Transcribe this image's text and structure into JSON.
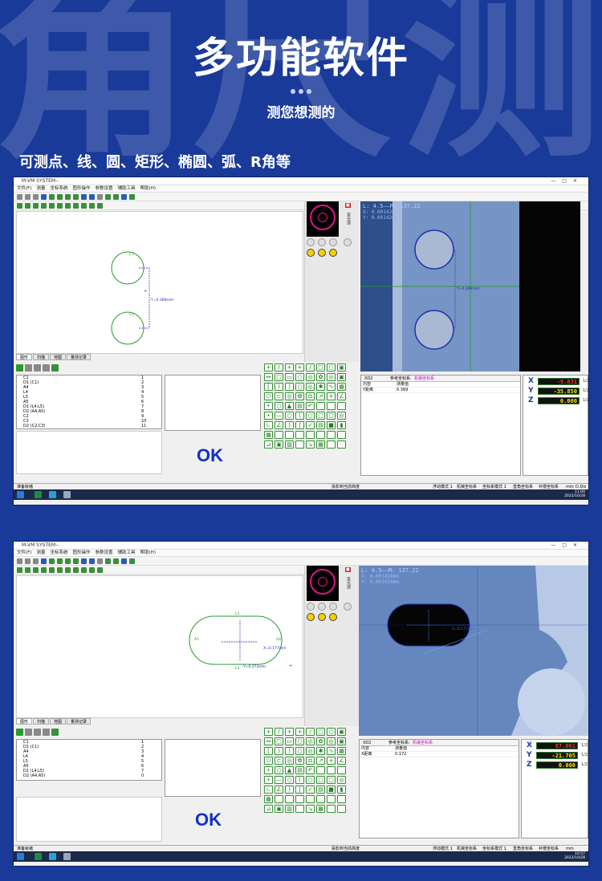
{
  "hero": {
    "background_chars": [
      "角",
      "尺",
      "测"
    ],
    "title": "多功能软件",
    "subtitle": "测您想测的",
    "feature_line": "可测点、线、圆、矩形、椭圆、弧、R角等"
  },
  "screens": [
    {
      "window_title": "M-VM SYSTEM--",
      "window_controls": [
        "—",
        "□",
        "✕"
      ],
      "menu": [
        "文件(F)",
        "测量",
        "坐标系统",
        "图形操作",
        "参数设置",
        "辅助工具",
        "帮助(H)"
      ],
      "drawing_labels": {
        "c_top": "C7",
        "c_bottom": "C3",
        "dimension": "Y=0.369mm"
      },
      "canvas_tabs": [
        "图形",
        "扫描",
        "地图",
        "量测记录"
      ],
      "cam_side_label": "查光源",
      "camera_readout": {
        "line1": "L: 4.5——M: 137.22",
        "line2": "X: 0.001428mm",
        "line3": "Y: 0.001426mm",
        "dimension": "Y=0.369mm"
      },
      "steps": [
        {
          "label": "C1",
          "num": "1"
        },
        {
          "label": "D1 (C1)",
          "num": "2"
        },
        {
          "label": "A4",
          "num": "3"
        },
        {
          "label": "L4",
          "num": "4"
        },
        {
          "label": "L5",
          "num": "5"
        },
        {
          "label": "A5",
          "num": "6"
        },
        {
          "label": "D1 (L4,L5)",
          "num": "7"
        },
        {
          "label": "D2 (A4,A5)",
          "num": "8"
        },
        {
          "label": "C2",
          "num": "9"
        },
        {
          "label": "C3",
          "num": "10"
        },
        {
          "label": "D2 (C2,C3)",
          "num": "11"
        }
      ],
      "ok_text": "OK",
      "results": {
        "id": "XD2",
        "ref_label": "参考坐标系:",
        "ref_value": "机械坐标系",
        "col1": "内容",
        "col2": "测量值",
        "rows": [
          {
            "name": "Y距离",
            "value": "0.369"
          }
        ]
      },
      "dro": [
        {
          "axis": "X",
          "value": "-9.831",
          "unit": "1/2"
        },
        {
          "axis": "Y",
          "value": "-35.850",
          "unit": "1/2"
        },
        {
          "axis": "Z",
          "value": "0.000",
          "unit": "1/2"
        }
      ],
      "status": {
        "left": "准备就绪",
        "mid": "投影到当前高度",
        "mode1": "浮动模式 1",
        "coord1": "机械坐标系",
        "mode2": "坐标系模式 1",
        "coord2": "直角坐标系",
        "comp": "补偿坐标系",
        "unit": "mm",
        "extra": "D.Dis"
      },
      "clock": {
        "time": "11:00",
        "date": "2022/10/28"
      }
    },
    {
      "window_title": "M-VM SYSTEM--",
      "window_controls": [
        "—",
        "□",
        "✕"
      ],
      "menu": [
        "文件(F)",
        "测量",
        "坐标系统",
        "图形操作",
        "参数设置",
        "辅助工具",
        "帮助(H)"
      ],
      "drawing_labels": {
        "l5": "L5",
        "l4": "L4",
        "a5": "A5",
        "a4": "A4",
        "dim_x": "X=0.177mm",
        "dim_y": "Y=0.273mm"
      },
      "canvas_tabs": [
        "图形",
        "扫描",
        "地图",
        "量测记录"
      ],
      "cam_side_label": "查光源",
      "camera_readout": {
        "line1": "L: 4.5——M: 137.22",
        "line2": "X: 0.001428mm",
        "line3": "Y: 0.001426mm",
        "dimension": "X=0.177mm"
      },
      "steps": [
        {
          "label": "C1",
          "num": "1"
        },
        {
          "label": "D1 (C1)",
          "num": "2"
        },
        {
          "label": "A4",
          "num": "3"
        },
        {
          "label": "L4",
          "num": "4"
        },
        {
          "label": "L5",
          "num": "5"
        },
        {
          "label": "A5",
          "num": "6"
        },
        {
          "label": "D1 (L4,L5)",
          "num": "7"
        },
        {
          "label": "D2 (A4,A5)",
          "num": "0"
        }
      ],
      "ok_text": "OK",
      "results": {
        "id": "XD2",
        "ref_label": "参考坐标系:",
        "ref_value": "机械坐标系",
        "col1": "内容",
        "col2": "测量值",
        "rows": [
          {
            "name": "X距离",
            "value": "0.172"
          }
        ]
      },
      "dro": [
        {
          "axis": "X",
          "value": "87.061",
          "unit": "1/2"
        },
        {
          "axis": "Y",
          "value": "-21.705",
          "unit": "1/2"
        },
        {
          "axis": "Z",
          "value": "0.000",
          "unit": "1/2"
        }
      ],
      "status": {
        "left": "准备就绪",
        "mid": "投影到当前高度",
        "mode1": "浮动模式 1",
        "coord1": "机械坐标系",
        "mode2": "坐标系模式 1",
        "coord2": "直角坐标系",
        "comp": "补偿坐标系",
        "unit": "mm",
        "extra": ""
      },
      "clock": {
        "time": "10:57",
        "date": "2022/10/28"
      }
    }
  ]
}
